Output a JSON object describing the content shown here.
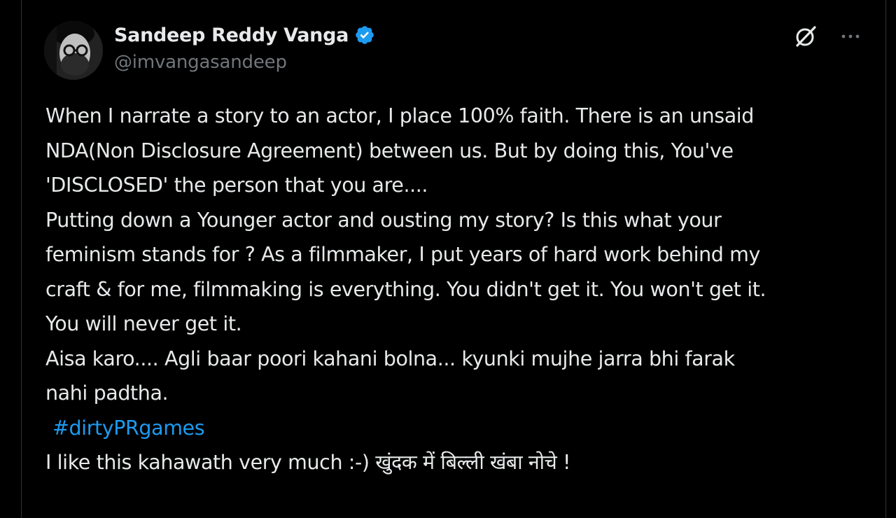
{
  "author": {
    "display_name": "Sandeep Reddy Vanga",
    "handle": "@imvangasandeep",
    "verified": true
  },
  "header_icons": {
    "grok": "grok-icon",
    "more": "more-options-icon"
  },
  "tweet": {
    "lines": [
      "When I narrate a story to an actor, I place 100% faith. There is an unsaid",
      "NDA(Non Disclosure Agreement) between us. But by doing this, You've",
      "'DISCLOSED' the person that you are....",
      "Putting down a Younger actor and ousting my story?  Is this what your",
      "feminism stands for ? As a filmmaker, I put years of hard work behind my",
      "craft & for me, filmmaking is everything. You didn't get it. You won't get it.",
      "You will never get it.",
      "Aisa karo.... Agli baar poori kahani bolna... kyunki mujhe jarra bhi farak",
      "nahi padtha."
    ],
    "hashtag": "#dirtyPRgames",
    "closing_line": "I like this kahawath very much :-) खुंदक में बिल्ली खंबा नोचे !"
  },
  "colors": {
    "background": "#000000",
    "text": "#e7e9ea",
    "secondary_text": "#71767b",
    "link": "#1d9bf0",
    "border": "#2f3336"
  }
}
